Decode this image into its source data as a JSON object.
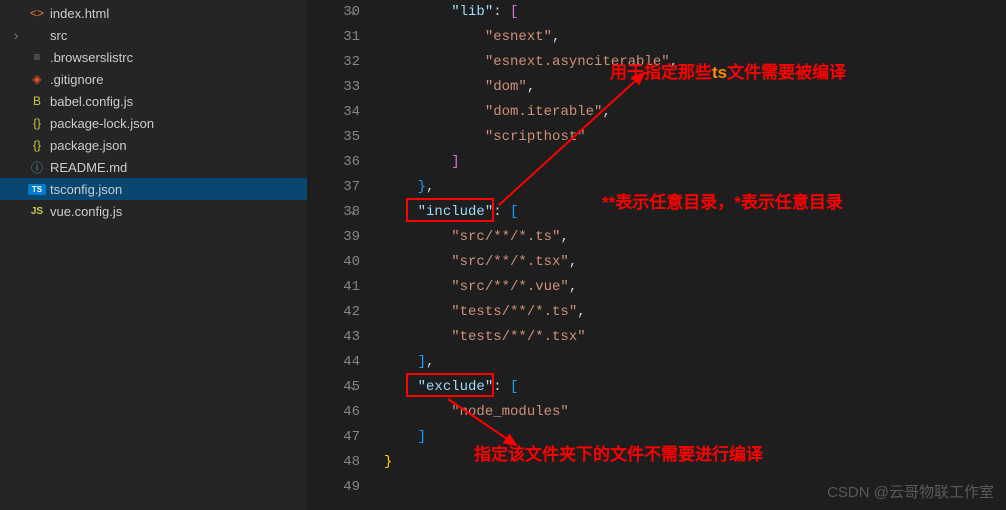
{
  "sidebar": {
    "items": [
      {
        "label": "index.html",
        "type": "html"
      },
      {
        "label": "src",
        "type": "folder"
      },
      {
        "label": ".browserslistrc",
        "type": "config"
      },
      {
        "label": ".gitignore",
        "type": "git"
      },
      {
        "label": "babel.config.js",
        "type": "babel"
      },
      {
        "label": "package-lock.json",
        "type": "json"
      },
      {
        "label": "package.json",
        "type": "json"
      },
      {
        "label": "README.md",
        "type": "readme"
      },
      {
        "label": "tsconfig.json",
        "type": "ts"
      },
      {
        "label": "vue.config.js",
        "type": "js"
      }
    ]
  },
  "editor": {
    "lines": [
      {
        "num": "30",
        "fold": true,
        "indent": 4,
        "tokens": [
          {
            "t": "\"lib\"",
            "c": "s-key"
          },
          {
            "t": ": ",
            "c": "s-pun"
          },
          {
            "t": "[",
            "c": "s-brk2"
          }
        ]
      },
      {
        "num": "31",
        "indent": 6,
        "tokens": [
          {
            "t": "\"esnext\"",
            "c": "s-str"
          },
          {
            "t": ",",
            "c": "s-pun"
          }
        ]
      },
      {
        "num": "32",
        "indent": 6,
        "tokens": [
          {
            "t": "\"esnext.asynciterable\"",
            "c": "s-str"
          },
          {
            "t": ",",
            "c": "s-pun"
          }
        ]
      },
      {
        "num": "33",
        "indent": 6,
        "tokens": [
          {
            "t": "\"dom\"",
            "c": "s-str"
          },
          {
            "t": ",",
            "c": "s-pun"
          }
        ]
      },
      {
        "num": "34",
        "indent": 6,
        "tokens": [
          {
            "t": "\"dom.iterable\"",
            "c": "s-str"
          },
          {
            "t": ",",
            "c": "s-pun"
          }
        ]
      },
      {
        "num": "35",
        "indent": 6,
        "tokens": [
          {
            "t": "\"scripthost\"",
            "c": "s-str"
          }
        ]
      },
      {
        "num": "36",
        "indent": 4,
        "tokens": [
          {
            "t": "]",
            "c": "s-brk2"
          }
        ]
      },
      {
        "num": "37",
        "indent": 2,
        "tokens": [
          {
            "t": "}",
            "c": "s-brk3"
          },
          {
            "t": ",",
            "c": "s-pun"
          }
        ]
      },
      {
        "num": "38",
        "fold": true,
        "indent": 2,
        "tokens": [
          {
            "t": "\"include\"",
            "c": "s-key"
          },
          {
            "t": ": ",
            "c": "s-pun"
          },
          {
            "t": "[",
            "c": "s-brk3"
          }
        ]
      },
      {
        "num": "39",
        "indent": 4,
        "tokens": [
          {
            "t": "\"src/**/*.ts\"",
            "c": "s-str"
          },
          {
            "t": ",",
            "c": "s-pun"
          }
        ]
      },
      {
        "num": "40",
        "indent": 4,
        "tokens": [
          {
            "t": "\"src/**/*.tsx\"",
            "c": "s-str"
          },
          {
            "t": ",",
            "c": "s-pun"
          }
        ]
      },
      {
        "num": "41",
        "indent": 4,
        "tokens": [
          {
            "t": "\"src/**/*.vue\"",
            "c": "s-str"
          },
          {
            "t": ",",
            "c": "s-pun"
          }
        ]
      },
      {
        "num": "42",
        "indent": 4,
        "tokens": [
          {
            "t": "\"tests/**/*.ts\"",
            "c": "s-str"
          },
          {
            "t": ",",
            "c": "s-pun"
          }
        ]
      },
      {
        "num": "43",
        "indent": 4,
        "tokens": [
          {
            "t": "\"tests/**/*.tsx\"",
            "c": "s-str"
          }
        ]
      },
      {
        "num": "44",
        "indent": 2,
        "tokens": [
          {
            "t": "]",
            "c": "s-brk3"
          },
          {
            "t": ",",
            "c": "s-pun"
          }
        ]
      },
      {
        "num": "45",
        "fold": true,
        "indent": 2,
        "tokens": [
          {
            "t": "\"exclude\"",
            "c": "s-key"
          },
          {
            "t": ": ",
            "c": "s-pun"
          },
          {
            "t": "[",
            "c": "s-brk3"
          }
        ]
      },
      {
        "num": "46",
        "indent": 4,
        "tokens": [
          {
            "t": "\"node_modules\"",
            "c": "s-str"
          }
        ]
      },
      {
        "num": "47",
        "indent": 2,
        "tokens": [
          {
            "t": "]",
            "c": "s-brk3"
          }
        ]
      },
      {
        "num": "48",
        "indent": 0,
        "tokens": [
          {
            "t": "}",
            "c": "s-brk"
          }
        ]
      },
      {
        "num": "49",
        "indent": 0,
        "tokens": []
      }
    ]
  },
  "annotations": {
    "a1_pre": "用于指定那些",
    "a1_mid": "ts",
    "a1_post": "文件需要被编译",
    "a2": "**表示任意目录，*表示任意目录",
    "a3": "指定该文件夹下的文件不需要进行编译"
  },
  "watermark": "CSDN @云哥物联工作室"
}
